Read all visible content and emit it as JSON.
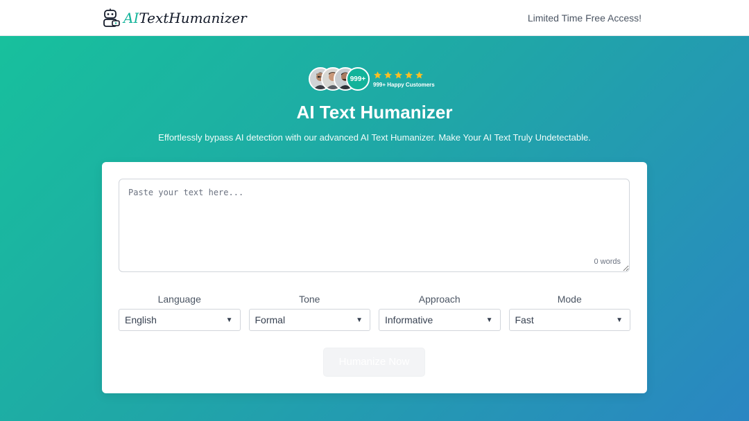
{
  "header": {
    "logo": {
      "ai": "AI",
      "rest": "TextHumanizer"
    },
    "promo_icon": "",
    "promo_text": "Limited Time Free Access!"
  },
  "social": {
    "counter": "999+",
    "stars": 5,
    "caption": "999+ Happy Customers",
    "star_color": "#fbbf24"
  },
  "hero": {
    "title": "AI Text Humanizer",
    "subtitle": "Effortlessly bypass AI detection with our advanced AI Text Humanizer. Make Your AI Text Truly Undetectable."
  },
  "editor": {
    "placeholder": "Paste your text here...",
    "value": "",
    "word_count": "0 words"
  },
  "options": [
    {
      "label": "Language",
      "value": "English"
    },
    {
      "label": "Tone",
      "value": "Formal"
    },
    {
      "label": "Approach",
      "value": "Informative"
    },
    {
      "label": "Mode",
      "value": "Fast"
    }
  ],
  "submit_label": "Humanize Now",
  "colors": {
    "accent": "#12b39a",
    "gradient_start": "#17c29c",
    "gradient_end": "#2a86c2"
  }
}
